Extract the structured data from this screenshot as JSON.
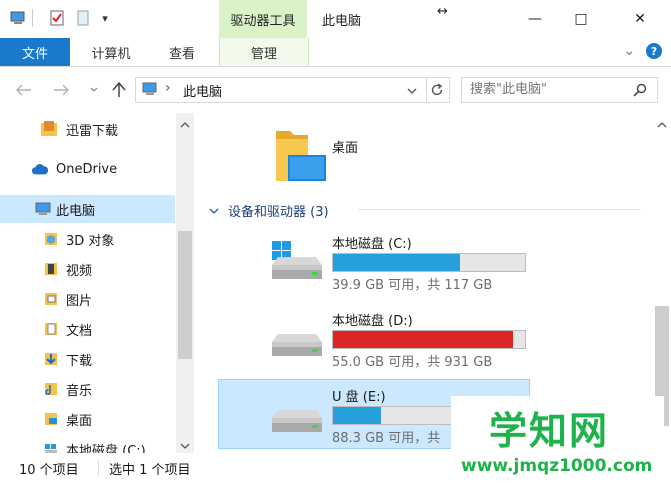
{
  "titlebar": {
    "context_tab": "驱动器工具",
    "title": "此电脑",
    "qat_dropdown": "▾",
    "resize_glyph": "↔",
    "buttons": {
      "minimize": "—",
      "maximize": "□",
      "close": "✕"
    }
  },
  "ribbon": {
    "tabs": [
      "文件",
      "计算机",
      "查看",
      "管理"
    ],
    "expand_glyph": "⌄",
    "help_glyph": "?"
  },
  "address": {
    "path_separator": "›",
    "location": "此电脑",
    "search_placeholder": "搜索\"此电脑\""
  },
  "nav": {
    "items": [
      {
        "label": "迅雷下载",
        "icon": "folder-icon"
      },
      {
        "label": "OneDrive",
        "icon": "cloud-icon"
      },
      {
        "label": "此电脑",
        "icon": "computer-icon",
        "selected": true
      },
      {
        "label": "3D 对象",
        "icon": "cube-folder-icon"
      },
      {
        "label": "视频",
        "icon": "video-folder-icon"
      },
      {
        "label": "图片",
        "icon": "pictures-folder-icon"
      },
      {
        "label": "文档",
        "icon": "documents-folder-icon"
      },
      {
        "label": "下载",
        "icon": "downloads-folder-icon"
      },
      {
        "label": "音乐",
        "icon": "music-folder-icon"
      },
      {
        "label": "桌面",
        "icon": "desktop-folder-icon"
      },
      {
        "label": "本地磁盘 (C:)",
        "icon": "drive-icon"
      }
    ]
  },
  "content": {
    "desktop_item": "桌面",
    "group_header": "设备和驱动器 (3)",
    "drives": [
      {
        "name": "本地磁盘 (C:)",
        "size_text": "39.9 GB 可用，共 117 GB",
        "used_fraction": 0.66,
        "color": "#26a0da",
        "icon": "windows-drive-icon"
      },
      {
        "name": "本地磁盘 (D:)",
        "size_text": "55.0 GB 可用，共 931 GB",
        "used_fraction": 0.94,
        "color": "#da2626",
        "icon": "drive-icon"
      },
      {
        "name": "U 盘 (E:)",
        "size_text": "88.3 GB 可用，共",
        "used_fraction": 0.25,
        "color": "#26a0da",
        "icon": "usb-drive-icon",
        "selected": true
      }
    ]
  },
  "status": {
    "item_count": "10 个项目",
    "selection": "选中 1 个项目"
  },
  "watermark": {
    "brand": "学知网",
    "url": "www.jmqz1000.com"
  },
  "colors": {
    "accent": "#1979ca",
    "selection": "#cce8ff",
    "context_tab": "#d9f2c7",
    "drive_ok": "#26a0da",
    "drive_full": "#da2626",
    "watermark_green": "#1db24a"
  }
}
